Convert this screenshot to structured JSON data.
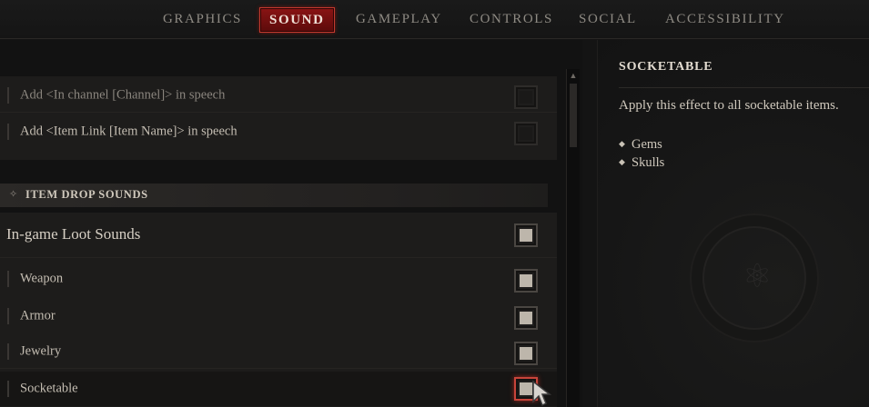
{
  "tabs": [
    {
      "label": "GRAPHICS",
      "active": false
    },
    {
      "label": "SOUND",
      "active": true
    },
    {
      "label": "GAMEPLAY",
      "active": false
    },
    {
      "label": "CONTROLS",
      "active": false
    },
    {
      "label": "SOCIAL",
      "active": false
    },
    {
      "label": "ACCESSIBILITY",
      "active": false
    }
  ],
  "speech_options": [
    {
      "label": "Add <In channel [Channel]> in speech",
      "checked": false
    },
    {
      "label": "Add <Item Link [Item Name]> in speech",
      "checked": false
    }
  ],
  "item_drop_section": {
    "title": "ITEM DROP SOUNDS",
    "group_title": "In-game Loot Sounds",
    "group_checked": true,
    "items": [
      {
        "label": "Weapon",
        "checked": true
      },
      {
        "label": "Armor",
        "checked": true
      },
      {
        "label": "Jewelry",
        "checked": true
      },
      {
        "label": "Socketable",
        "checked": true
      }
    ]
  },
  "info_panel": {
    "title": "SOCKETABLE",
    "description": "Apply this effect to all socketable items.",
    "list": [
      "Gems",
      "Skulls"
    ]
  },
  "colors": {
    "accent_red": "#8a1414",
    "background": "#141414",
    "text": "#c9c2b6"
  },
  "icons": {
    "section": "diamond-icon",
    "scroll_up": "triangle-up-icon",
    "cursor": "pointer-cursor-icon",
    "emblem": "horned-emblem-icon"
  }
}
